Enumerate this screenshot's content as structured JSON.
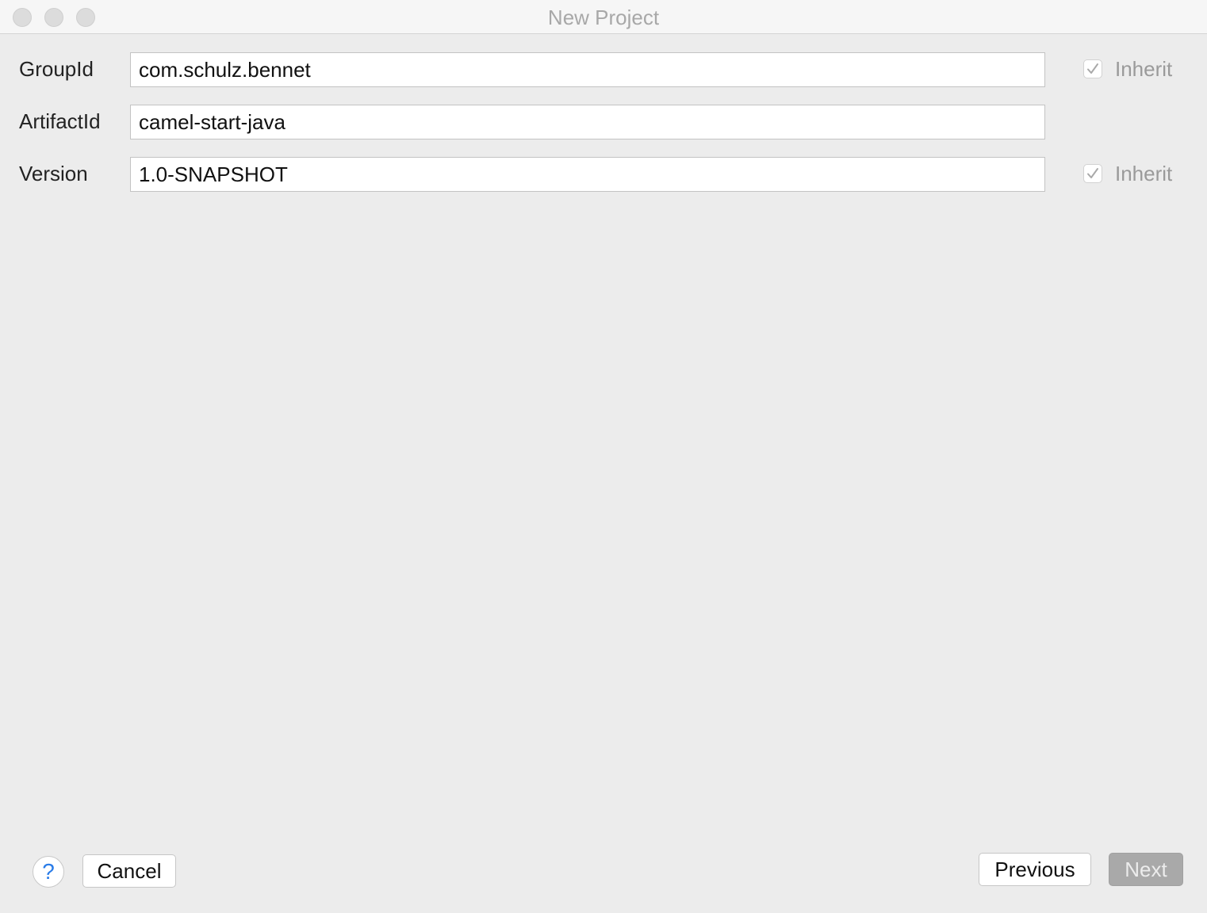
{
  "window": {
    "title": "New Project"
  },
  "form": {
    "fields": [
      {
        "label": "GroupId",
        "value": "com.schulz.bennet",
        "inherit": {
          "visible": true,
          "checked": true,
          "label": "Inherit"
        }
      },
      {
        "label": "ArtifactId",
        "value": "camel-start-java",
        "inherit": {
          "visible": false
        }
      },
      {
        "label": "Version",
        "value": "1.0-SNAPSHOT",
        "inherit": {
          "visible": true,
          "checked": true,
          "label": "Inherit"
        }
      }
    ]
  },
  "footer": {
    "help_label": "?",
    "cancel_label": "Cancel",
    "previous_label": "Previous",
    "next_label": "Next",
    "next_enabled": false
  },
  "icons": {
    "help": "question-mark-icon",
    "checkbox": "checkmark-icon"
  },
  "colors": {
    "window_bg": "#ececec",
    "help_accent": "#2a7ce8",
    "disabled_button": "#a9a9a9"
  }
}
